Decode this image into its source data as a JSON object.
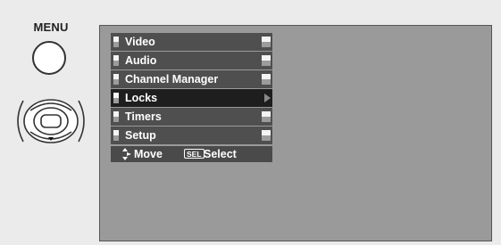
{
  "remote": {
    "menu_label": "MENU"
  },
  "menu": {
    "items": [
      {
        "label": "Video",
        "selected": false
      },
      {
        "label": "Audio",
        "selected": false
      },
      {
        "label": "Channel Manager",
        "selected": false
      },
      {
        "label": "Locks",
        "selected": true
      },
      {
        "label": "Timers",
        "selected": false
      },
      {
        "label": "Setup",
        "selected": false
      }
    ]
  },
  "hint": {
    "move_label": "Move",
    "sel_badge": "SEL",
    "select_label": "Select"
  },
  "colors": {
    "screen_bg": "#9a9a9a",
    "item_bg": "#4f4f4f",
    "selected_bg": "#1e1e1e",
    "page_bg": "#ebebeb"
  },
  "icons": [
    "menu-button-icon",
    "dpad-icon",
    "move-arrows-icon",
    "submenu-arrow-icon"
  ]
}
